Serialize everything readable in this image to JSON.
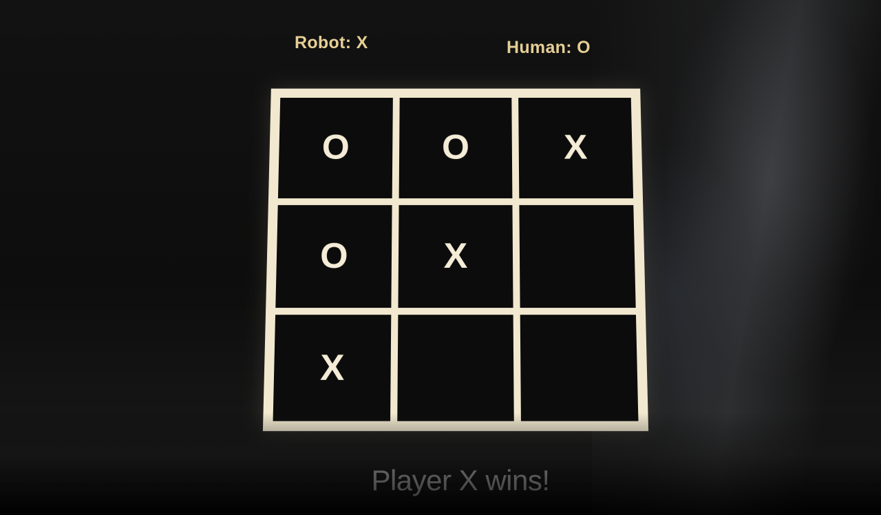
{
  "header": {
    "robot_label": "Robot: X",
    "human_label": "Human: O"
  },
  "board": {
    "cells": [
      {
        "mark": "O"
      },
      {
        "mark": "O"
      },
      {
        "mark": "X"
      },
      {
        "mark": "O"
      },
      {
        "mark": "X"
      },
      {
        "mark": ""
      },
      {
        "mark": "X"
      },
      {
        "mark": ""
      },
      {
        "mark": ""
      }
    ]
  },
  "status": {
    "message": "Player X wins!"
  },
  "colors": {
    "background": "#0b0b0b",
    "board_frame": "#f1e8cf",
    "cell": "#0c0c0c",
    "label": "#e6cf95",
    "mark": "#f4ecd6"
  }
}
